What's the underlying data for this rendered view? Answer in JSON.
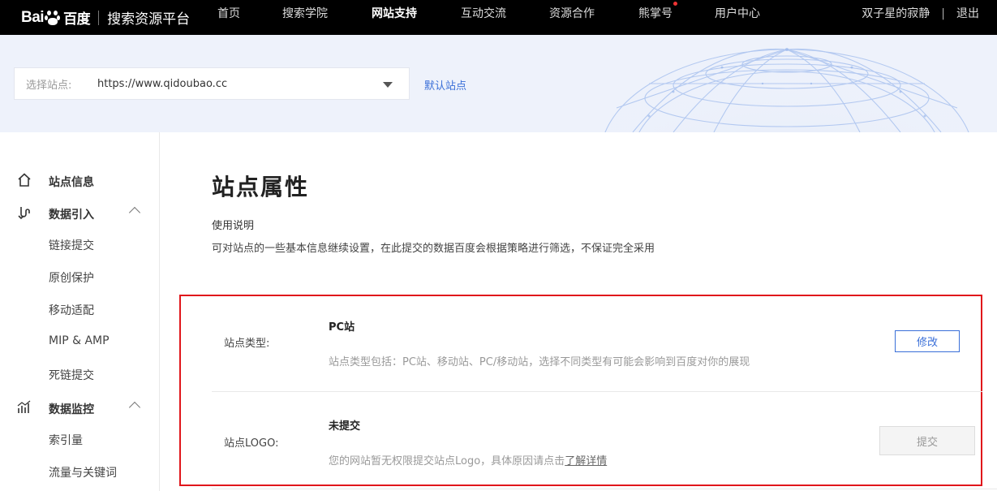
{
  "header": {
    "logo_text": "Bai",
    "logo_text_2": "百度",
    "platform_title": "搜索资源平台",
    "nav": [
      {
        "label": "首页"
      },
      {
        "label": "搜索学院"
      },
      {
        "label": "网站支持"
      },
      {
        "label": "互动交流"
      },
      {
        "label": "资源合作"
      },
      {
        "label": "熊掌号"
      },
      {
        "label": "用户中心"
      }
    ],
    "username": "双子星的寂静",
    "separator": "|",
    "logout": "退出"
  },
  "site_selector": {
    "label": "选择站点:",
    "value": "https://www.qidoubao.cc",
    "default_link": "默认站点"
  },
  "sidebar": {
    "items": [
      {
        "label": "站点信息",
        "icon": "home-icon"
      },
      {
        "label": "数据引入",
        "icon": "data-import-icon"
      },
      {
        "label": "链接提交"
      },
      {
        "label": "原创保护"
      },
      {
        "label": "移动适配"
      },
      {
        "label": "MIP & AMP"
      },
      {
        "label": "死链提交"
      },
      {
        "label": "数据监控",
        "icon": "chart-monitor-icon"
      },
      {
        "label": "索引量"
      },
      {
        "label": "流量与关键词"
      }
    ]
  },
  "main": {
    "title": "站点属性",
    "usage_title": "使用说明",
    "usage_desc": "可对站点的一些基本信息继续设置，在此提交的数据百度会根据策略进行筛选，不保证完全采用",
    "rows": [
      {
        "label": "站点类型:",
        "value": "PC站",
        "note": "站点类型包括：PC站、移动站、PC/移动站，选择不同类型有可能会影响到百度对你的展现",
        "button": "修改"
      },
      {
        "label": "站点LOGO:",
        "value": "未提交",
        "note": "您的网站暂无权限提交站点Logo，具体原因请点击",
        "note_link": "了解详情",
        "button": "提交"
      }
    ]
  },
  "colors": {
    "topbar": "#000000",
    "banner": "#eef2fb",
    "accent_blue": "#3a6fd8",
    "highlight_red": "#e0161b"
  }
}
